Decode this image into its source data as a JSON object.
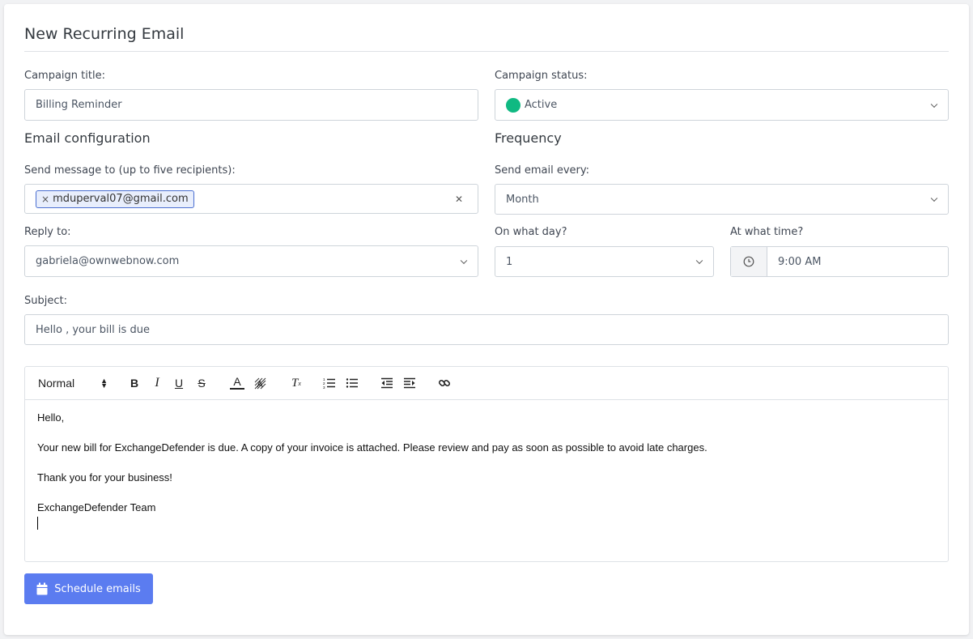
{
  "form": {
    "title": "New Recurring Email",
    "campaign_title_label": "Campaign title:",
    "campaign_title_value": "Billing Reminder",
    "campaign_status_label": "Campaign status:",
    "campaign_status_value": "Active",
    "email_config_heading": "Email configuration",
    "frequency_heading": "Frequency",
    "send_to_label": "Send message to (up to five recipients):",
    "recipients": [
      "mduperval07@gmail.com"
    ],
    "send_every_label": "Send email every:",
    "send_every_value": "Month",
    "reply_to_label": "Reply to:",
    "reply_to_value": "gabriela@ownwebnow.com",
    "day_label": "On what day?",
    "day_value": "1",
    "time_label": "At what time?",
    "time_value": "9:00 AM",
    "subject_label": "Subject:",
    "subject_value": "Hello , your bill is due"
  },
  "editor": {
    "format_select": "Normal",
    "toolbar_icons": [
      "bold-icon",
      "italic-icon",
      "underline-icon",
      "strike-icon",
      "text-color-icon",
      "background-color-icon",
      "clear-format-icon",
      "ordered-list-icon",
      "bullet-list-icon",
      "outdent-icon",
      "indent-icon",
      "link-icon"
    ],
    "body": [
      "Hello,",
      "Your new bill for ExchangeDefender is due. A copy of your invoice is attached. Please review and pay as soon as possible to avoid late charges.",
      "Thank you for your business!",
      "ExchangeDefender Team"
    ]
  },
  "actions": {
    "schedule_label": "Schedule emails"
  },
  "colors": {
    "accent": "#5b7cf0",
    "status_active": "#10b982",
    "chip_border": "#4a6fd1"
  }
}
